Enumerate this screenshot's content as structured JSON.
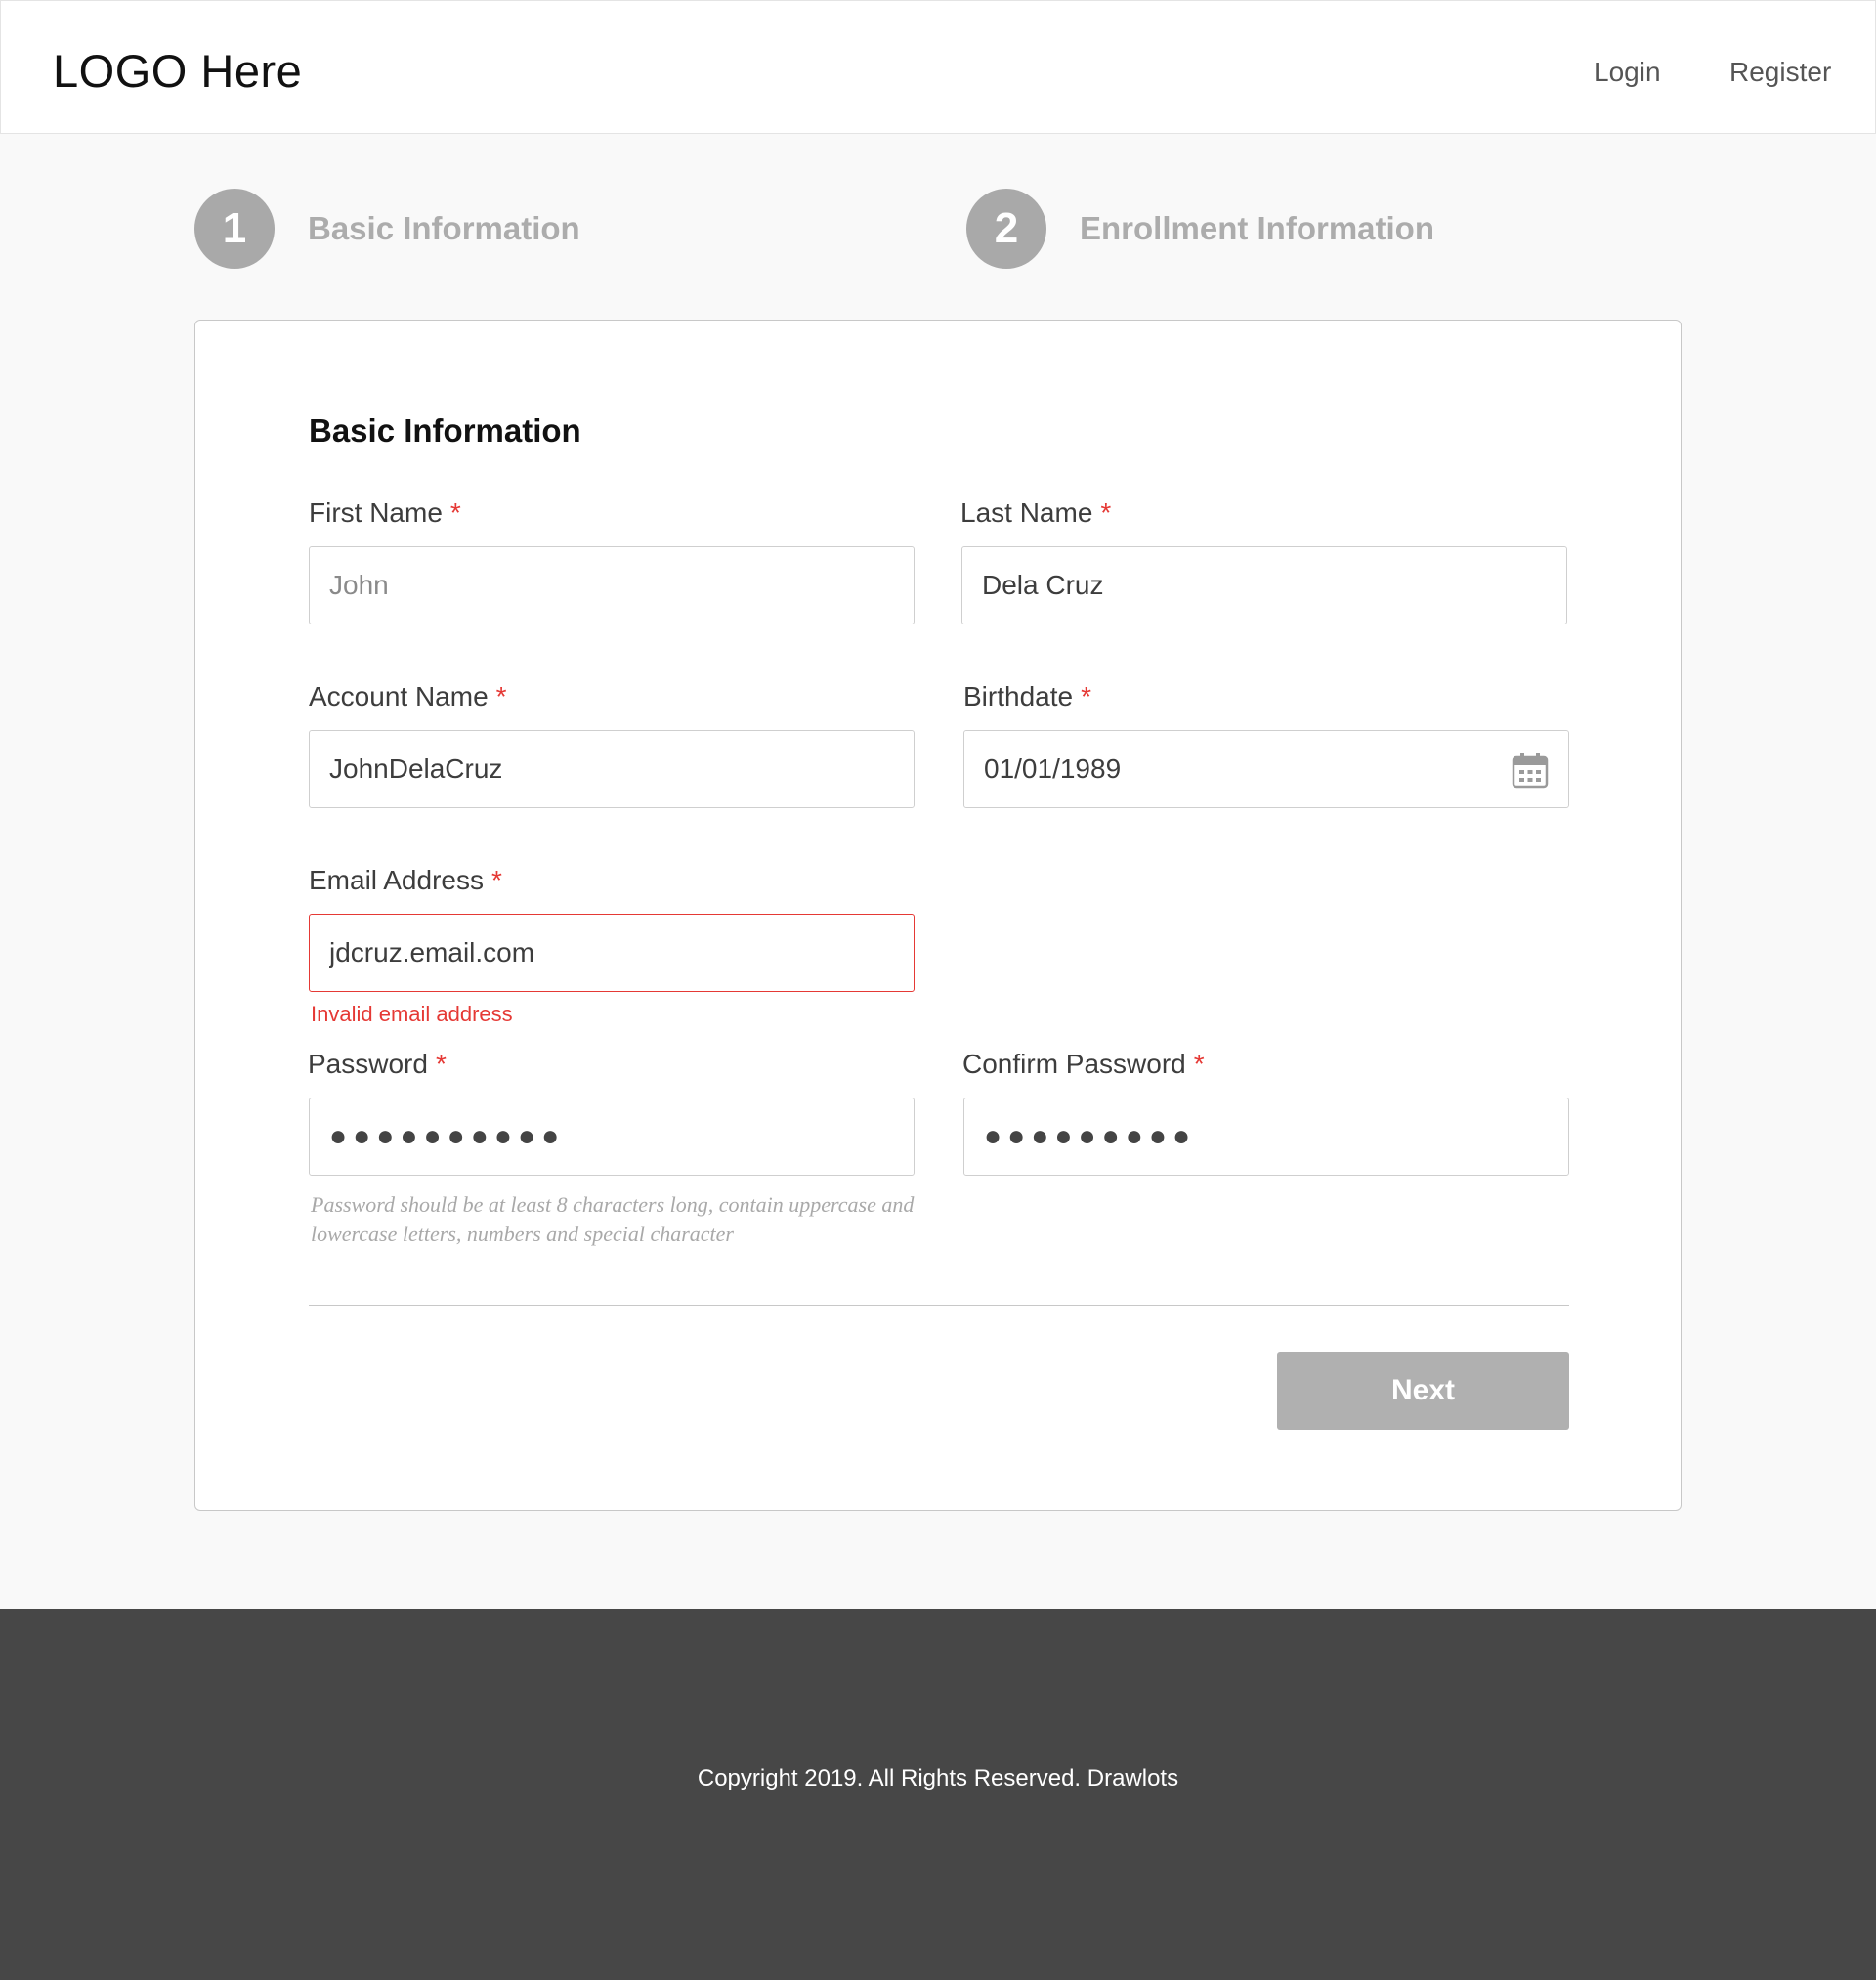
{
  "header": {
    "logo": "LOGO Here",
    "nav": {
      "login": "Login",
      "register": "Register"
    }
  },
  "steps": [
    {
      "number": "1",
      "label": "Basic Information"
    },
    {
      "number": "2",
      "label": "Enrollment Information"
    }
  ],
  "form": {
    "title": "Basic Information",
    "required_marker": "*",
    "first_name": {
      "label": "First Name",
      "value": "",
      "placeholder": "John"
    },
    "last_name": {
      "label": "Last Name",
      "value": "Dela Cruz"
    },
    "account_name": {
      "label": "Account Name",
      "value": "JohnDelaCruz"
    },
    "birthdate": {
      "label": "Birthdate",
      "value": "01/01/1989",
      "icon": "calendar-icon"
    },
    "email": {
      "label": "Email Address",
      "value": "jdcruz.email.com",
      "error": "Invalid email address"
    },
    "password": {
      "label": "Password",
      "value": "●●●●●●●●●●",
      "help": "Password should be at least 8 characters long, contain uppercase and lowercase letters, numbers and special character"
    },
    "confirm_password": {
      "label": "Confirm Password",
      "value": "●●●●●●●●●"
    },
    "next_label": "Next"
  },
  "footer": {
    "copyright": "Copyright 2019. All Rights Reserved. Drawlots"
  },
  "colors": {
    "required": "#e53935",
    "error": "#e53935",
    "step_inactive": "#a9a9a9",
    "button_disabled": "#b0b0b0",
    "footer_bg": "#474747"
  }
}
